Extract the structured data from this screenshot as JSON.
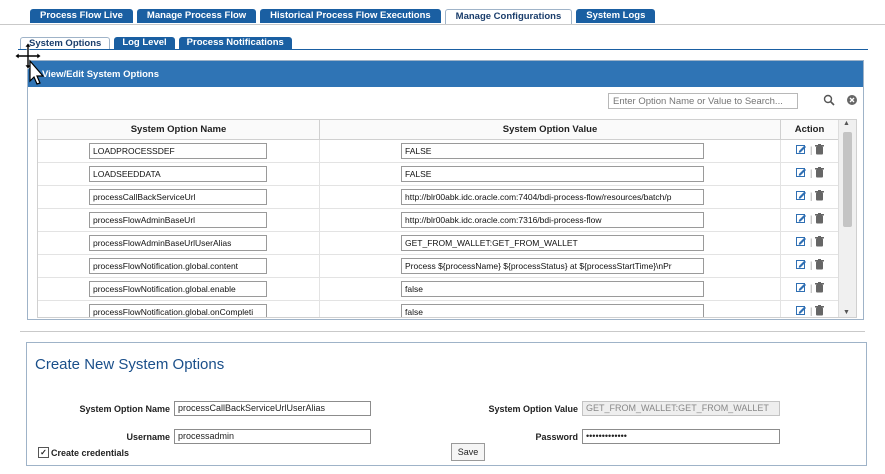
{
  "top_tabs": [
    {
      "label": "Process Flow Live"
    },
    {
      "label": "Manage Process Flow"
    },
    {
      "label": "Historical Process Flow Executions"
    },
    {
      "label": "Manage Configurations",
      "active": true
    },
    {
      "label": "System Logs"
    }
  ],
  "sub_tabs": [
    {
      "label": "System Options",
      "active": true
    },
    {
      "label": "Log Level"
    },
    {
      "label": "Process Notifications"
    }
  ],
  "panel": {
    "title": "View/Edit System Options",
    "search_placeholder": "Enter Option Name or Value to Search...",
    "icons": {
      "search": "search-icon",
      "clear": "clear-icon"
    }
  },
  "table": {
    "columns": [
      "System Option Name",
      "System Option Value",
      "Action"
    ],
    "rows": [
      {
        "name": "LOADPROCESSDEF",
        "value": "FALSE"
      },
      {
        "name": "LOADSEEDDATA",
        "value": "FALSE"
      },
      {
        "name": "processCallBackServiceUrl",
        "value": "http://blr00abk.idc.oracle.com:7404/bdi-process-flow/resources/batch/p"
      },
      {
        "name": "processFlowAdminBaseUrl",
        "value": "http://blr00abk.idc.oracle.com:7316/bdi-process-flow"
      },
      {
        "name": "processFlowAdminBaseUrlUserAlias",
        "value": "GET_FROM_WALLET:GET_FROM_WALLET"
      },
      {
        "name": "processFlowNotification.global.content",
        "value": "Process ${processName} ${processStatus} at ${processStartTime}\\nPr"
      },
      {
        "name": "processFlowNotification.global.enable",
        "value": "false"
      },
      {
        "name": "processFlowNotification.global.onCompleti",
        "value": "false"
      }
    ],
    "action_separator": "|"
  },
  "create": {
    "title": "Create New System Options",
    "option_name_label": "System Option Name",
    "option_name_value": "processCallBackServiceUrlUserAlias",
    "option_value_label": "System Option Value",
    "option_value_value": "GET_FROM_WALLET:GET_FROM_WALLET",
    "username_label": "Username",
    "username_value": "processadmin",
    "password_label": "Password",
    "password_value": "•••••••••••••",
    "credentials_label": "Create credentials",
    "credentials_checked": true,
    "save_label": "Save"
  },
  "colors": {
    "tab_blue": "#1a5fa2",
    "panel_header": "#2f74b5",
    "title_blue": "#1a4f8a"
  }
}
